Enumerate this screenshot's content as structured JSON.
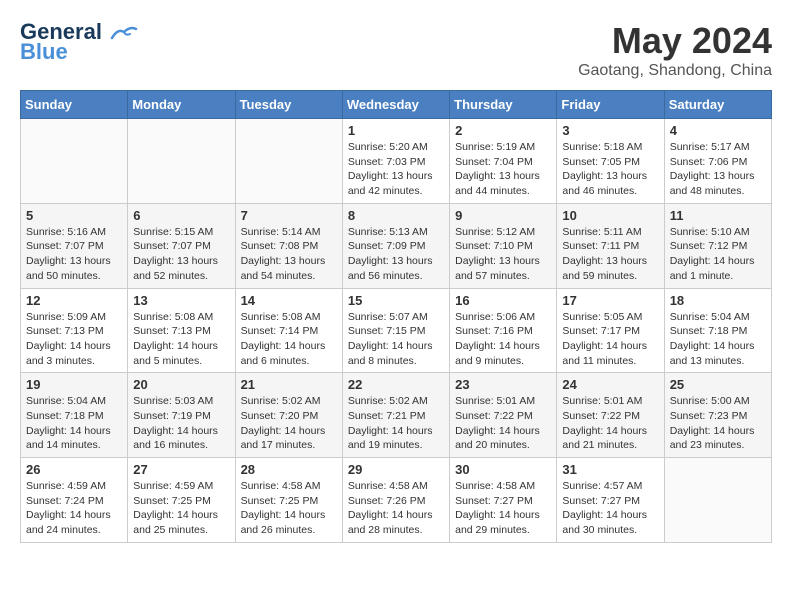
{
  "header": {
    "logo_line1": "General",
    "logo_line2": "Blue",
    "month_year": "May 2024",
    "location": "Gaotang, Shandong, China"
  },
  "weekdays": [
    "Sunday",
    "Monday",
    "Tuesday",
    "Wednesday",
    "Thursday",
    "Friday",
    "Saturday"
  ],
  "weeks": [
    [
      {
        "day": "",
        "info": ""
      },
      {
        "day": "",
        "info": ""
      },
      {
        "day": "",
        "info": ""
      },
      {
        "day": "1",
        "info": "Sunrise: 5:20 AM\nSunset: 7:03 PM\nDaylight: 13 hours\nand 42 minutes."
      },
      {
        "day": "2",
        "info": "Sunrise: 5:19 AM\nSunset: 7:04 PM\nDaylight: 13 hours\nand 44 minutes."
      },
      {
        "day": "3",
        "info": "Sunrise: 5:18 AM\nSunset: 7:05 PM\nDaylight: 13 hours\nand 46 minutes."
      },
      {
        "day": "4",
        "info": "Sunrise: 5:17 AM\nSunset: 7:06 PM\nDaylight: 13 hours\nand 48 minutes."
      }
    ],
    [
      {
        "day": "5",
        "info": "Sunrise: 5:16 AM\nSunset: 7:07 PM\nDaylight: 13 hours\nand 50 minutes."
      },
      {
        "day": "6",
        "info": "Sunrise: 5:15 AM\nSunset: 7:07 PM\nDaylight: 13 hours\nand 52 minutes."
      },
      {
        "day": "7",
        "info": "Sunrise: 5:14 AM\nSunset: 7:08 PM\nDaylight: 13 hours\nand 54 minutes."
      },
      {
        "day": "8",
        "info": "Sunrise: 5:13 AM\nSunset: 7:09 PM\nDaylight: 13 hours\nand 56 minutes."
      },
      {
        "day": "9",
        "info": "Sunrise: 5:12 AM\nSunset: 7:10 PM\nDaylight: 13 hours\nand 57 minutes."
      },
      {
        "day": "10",
        "info": "Sunrise: 5:11 AM\nSunset: 7:11 PM\nDaylight: 13 hours\nand 59 minutes."
      },
      {
        "day": "11",
        "info": "Sunrise: 5:10 AM\nSunset: 7:12 PM\nDaylight: 14 hours\nand 1 minute."
      }
    ],
    [
      {
        "day": "12",
        "info": "Sunrise: 5:09 AM\nSunset: 7:13 PM\nDaylight: 14 hours\nand 3 minutes."
      },
      {
        "day": "13",
        "info": "Sunrise: 5:08 AM\nSunset: 7:13 PM\nDaylight: 14 hours\nand 5 minutes."
      },
      {
        "day": "14",
        "info": "Sunrise: 5:08 AM\nSunset: 7:14 PM\nDaylight: 14 hours\nand 6 minutes."
      },
      {
        "day": "15",
        "info": "Sunrise: 5:07 AM\nSunset: 7:15 PM\nDaylight: 14 hours\nand 8 minutes."
      },
      {
        "day": "16",
        "info": "Sunrise: 5:06 AM\nSunset: 7:16 PM\nDaylight: 14 hours\nand 9 minutes."
      },
      {
        "day": "17",
        "info": "Sunrise: 5:05 AM\nSunset: 7:17 PM\nDaylight: 14 hours\nand 11 minutes."
      },
      {
        "day": "18",
        "info": "Sunrise: 5:04 AM\nSunset: 7:18 PM\nDaylight: 14 hours\nand 13 minutes."
      }
    ],
    [
      {
        "day": "19",
        "info": "Sunrise: 5:04 AM\nSunset: 7:18 PM\nDaylight: 14 hours\nand 14 minutes."
      },
      {
        "day": "20",
        "info": "Sunrise: 5:03 AM\nSunset: 7:19 PM\nDaylight: 14 hours\nand 16 minutes."
      },
      {
        "day": "21",
        "info": "Sunrise: 5:02 AM\nSunset: 7:20 PM\nDaylight: 14 hours\nand 17 minutes."
      },
      {
        "day": "22",
        "info": "Sunrise: 5:02 AM\nSunset: 7:21 PM\nDaylight: 14 hours\nand 19 minutes."
      },
      {
        "day": "23",
        "info": "Sunrise: 5:01 AM\nSunset: 7:22 PM\nDaylight: 14 hours\nand 20 minutes."
      },
      {
        "day": "24",
        "info": "Sunrise: 5:01 AM\nSunset: 7:22 PM\nDaylight: 14 hours\nand 21 minutes."
      },
      {
        "day": "25",
        "info": "Sunrise: 5:00 AM\nSunset: 7:23 PM\nDaylight: 14 hours\nand 23 minutes."
      }
    ],
    [
      {
        "day": "26",
        "info": "Sunrise: 4:59 AM\nSunset: 7:24 PM\nDaylight: 14 hours\nand 24 minutes."
      },
      {
        "day": "27",
        "info": "Sunrise: 4:59 AM\nSunset: 7:25 PM\nDaylight: 14 hours\nand 25 minutes."
      },
      {
        "day": "28",
        "info": "Sunrise: 4:58 AM\nSunset: 7:25 PM\nDaylight: 14 hours\nand 26 minutes."
      },
      {
        "day": "29",
        "info": "Sunrise: 4:58 AM\nSunset: 7:26 PM\nDaylight: 14 hours\nand 28 minutes."
      },
      {
        "day": "30",
        "info": "Sunrise: 4:58 AM\nSunset: 7:27 PM\nDaylight: 14 hours\nand 29 minutes."
      },
      {
        "day": "31",
        "info": "Sunrise: 4:57 AM\nSunset: 7:27 PM\nDaylight: 14 hours\nand 30 minutes."
      },
      {
        "day": "",
        "info": ""
      }
    ]
  ]
}
